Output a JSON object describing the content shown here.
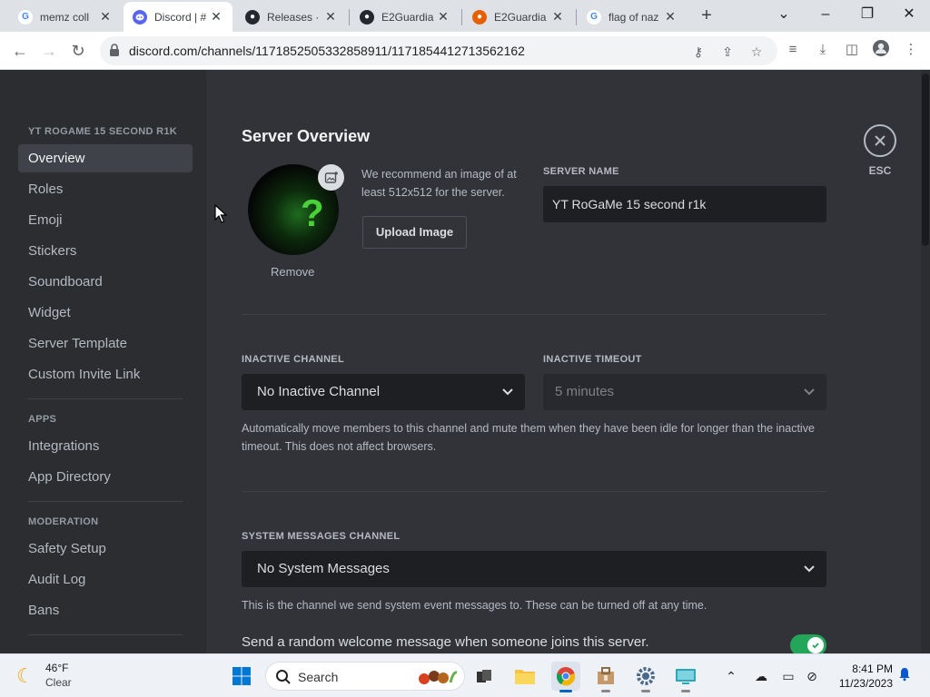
{
  "browser": {
    "tabs": [
      {
        "title": "memz coll",
        "favicon": "google-icon"
      },
      {
        "title": "Discord | #",
        "favicon": "discord-icon"
      },
      {
        "title": "Releases ·",
        "favicon": "github-icon"
      },
      {
        "title": "E2Guardia",
        "favicon": "github-icon"
      },
      {
        "title": "E2Guardia",
        "favicon": "firefox-icon"
      },
      {
        "title": "flag of naz",
        "favicon": "google-icon"
      }
    ],
    "active_tab": 1,
    "url": "discord.com/channels/1171852505332858911/1171854412713562162"
  },
  "sidebar": {
    "server_name": "YT ROGAME 15 SECOND R1K",
    "items": [
      "Overview",
      "Roles",
      "Emoji",
      "Stickers",
      "Soundboard",
      "Widget",
      "Server Template",
      "Custom Invite Link"
    ],
    "apps_header": "APPS",
    "apps_items": [
      "Integrations",
      "App Directory"
    ],
    "moderation_header": "MODERATION",
    "moderation_items": [
      "Safety Setup",
      "Audit Log",
      "Bans"
    ]
  },
  "overview": {
    "title": "Server Overview",
    "recommend_text": "We recommend an image of at least 512x512 for the server.",
    "upload_button": "Upload Image",
    "remove_link": "Remove",
    "server_name_label": "SERVER NAME",
    "server_name_value": "YT RoGaMe 15 second r1k",
    "inactive_channel_label": "INACTIVE CHANNEL",
    "inactive_channel_value": "No Inactive Channel",
    "inactive_timeout_label": "INACTIVE TIMEOUT",
    "inactive_timeout_value": "5 minutes",
    "inactive_help": "Automatically move members to this channel and mute them when they have been idle for longer than the inactive timeout. This does not affect browsers.",
    "system_label": "SYSTEM MESSAGES CHANNEL",
    "system_value": "No System Messages",
    "system_help": "This is the channel we send system event messages to. These can be turned off at any time.",
    "welcome_toggle_label": "Send a random welcome message when someone joins this server.",
    "welcome_toggle_on": true,
    "esc_label": "ESC"
  },
  "taskbar": {
    "temperature": "46°F",
    "condition": "Clear",
    "search_placeholder": "Search",
    "time": "8:41 PM",
    "date": "11/23/2023"
  },
  "colors": {
    "discord_bg": "#313338",
    "discord_sidebar": "#2b2d31",
    "toggle_on": "#23a55a",
    "chrome_tabstrip": "#dee1e6"
  }
}
